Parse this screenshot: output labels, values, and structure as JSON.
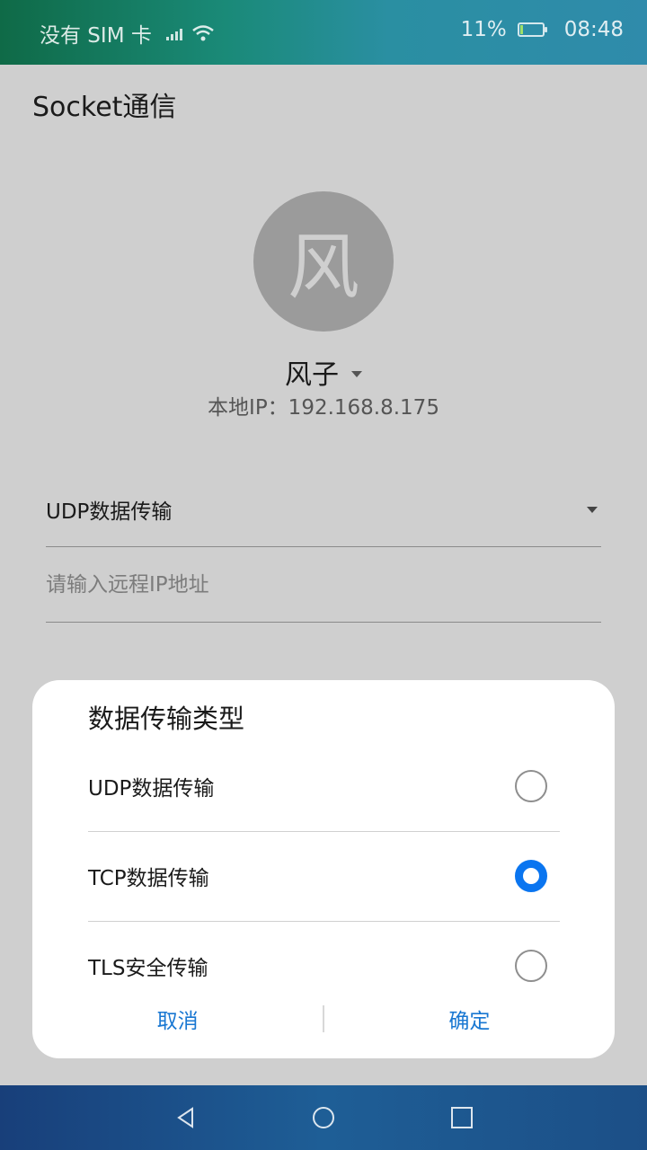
{
  "status_bar": {
    "carrier": "没有 SIM 卡",
    "battery_percent": "11%",
    "battery_level": 0.11,
    "time": "08:48",
    "icons": [
      "signal-icon",
      "wifi-icon",
      "battery-icon"
    ]
  },
  "app": {
    "title": "Socket通信",
    "avatar_char": "风",
    "user_name": "风子",
    "local_ip": "本地IP：192.168.8.175",
    "transfer_type_value": "UDP数据传输",
    "remote_ip_placeholder": "请输入远程IP地址"
  },
  "dialog": {
    "title": "数据传输类型",
    "options": [
      {
        "label": "UDP数据传输",
        "checked": false
      },
      {
        "label": "TCP数据传输",
        "checked": true
      },
      {
        "label": "TLS安全传输",
        "checked": false
      }
    ],
    "cancel_label": "取消",
    "confirm_label": "确定",
    "accent_color": "#0a75f0"
  },
  "nav_bar": {
    "icons": [
      "back-icon",
      "home-icon",
      "recents-icon"
    ]
  }
}
